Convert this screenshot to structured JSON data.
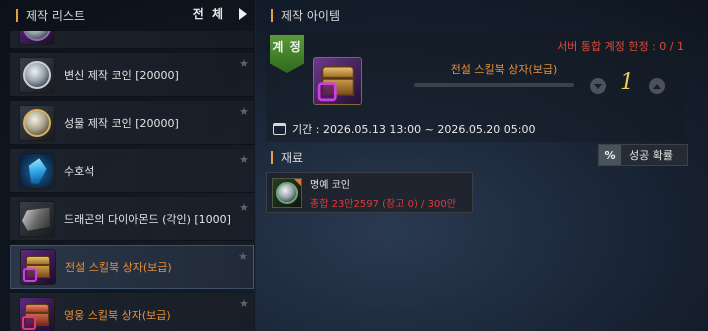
{
  "left": {
    "title": "제작 리스트",
    "filter_label": "전 체",
    "items": [
      {
        "label": "",
        "icon": "coin-icon",
        "selected": false
      },
      {
        "label": "변신 제작 코인 [20000]",
        "icon": "coin-icon",
        "selected": false
      },
      {
        "label": "성물 제작 코인 [20000]",
        "icon": "gold-coin-icon",
        "selected": false
      },
      {
        "label": "수호석",
        "icon": "blue-gem-icon",
        "selected": false
      },
      {
        "label": "드래곤의 다이아몬드 (각인) [1000]",
        "icon": "diamond-icon",
        "selected": false
      },
      {
        "label": "전설 스킬북 상자(보급)",
        "icon": "chest-icon",
        "selected": true
      },
      {
        "label": "영웅 스킬북 상자(보급)",
        "icon": "chest-icon",
        "selected": false
      }
    ]
  },
  "right": {
    "title": "제작 아이템",
    "account_tag": "계 정",
    "limit_text": "서버 통합 계정 한정 : 0 / 1",
    "item_name": "전설 스킬북 상자(보급)",
    "quantity": "1",
    "period": "기간 : 2026.05.13 13:00 ~ 2026.05.20 05:00",
    "materials_title": "재료",
    "rate_button_symbol": "%",
    "rate_button_label": "성공 확률",
    "material": {
      "name": "명예 코인",
      "count_text": "총합 23만2597 (창고 0) / 300만"
    }
  },
  "colors": {
    "accent_orange": "#e8903a",
    "warning_red": "#e04a3a",
    "quantity_gold": "#f0c860",
    "account_green": "#4a8a2e"
  }
}
